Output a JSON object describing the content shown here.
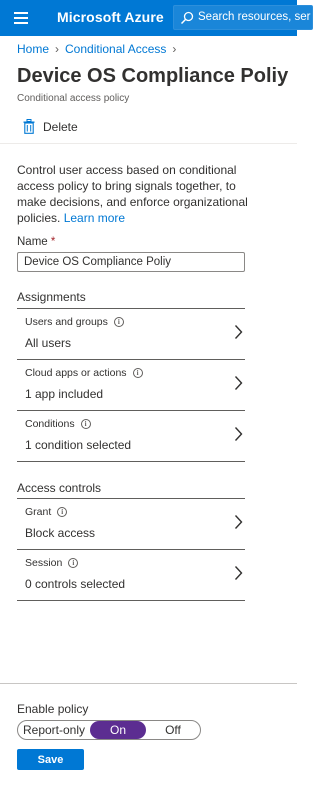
{
  "topbar": {
    "brand": "Microsoft Azure",
    "search_placeholder": "Search resources, ser",
    "bg_color": "#0078d4"
  },
  "breadcrumb": [
    {
      "label": "Home"
    },
    {
      "label": "Conditional Access"
    }
  ],
  "page": {
    "title": "Device OS Compliance Poliy",
    "subtitle": "Conditional access policy"
  },
  "commands": {
    "delete_label": "Delete"
  },
  "description": {
    "text": "Control user access based on conditional access policy to bring signals together, to make decisions, and enforce organizational policies.",
    "link": "Learn more"
  },
  "name_field": {
    "label": "Name",
    "required_mark": "*",
    "value": "Device OS Compliance Poliy"
  },
  "assignments": {
    "header": "Assignments",
    "rows": [
      {
        "title": "Users and groups",
        "value": "All users"
      },
      {
        "title": "Cloud apps or actions",
        "value": "1 app included"
      },
      {
        "title": "Conditions",
        "value": "1 condition selected"
      }
    ]
  },
  "access_controls": {
    "header": "Access controls",
    "rows": [
      {
        "title": "Grant",
        "value": "Block access"
      },
      {
        "title": "Session",
        "value": "0 controls selected"
      }
    ]
  },
  "footer": {
    "enable_label": "Enable policy",
    "options": [
      "Report-only",
      "On",
      "Off"
    ],
    "selected": "On",
    "save_label": "Save",
    "toggle_selected_color": "#5c2d91"
  }
}
